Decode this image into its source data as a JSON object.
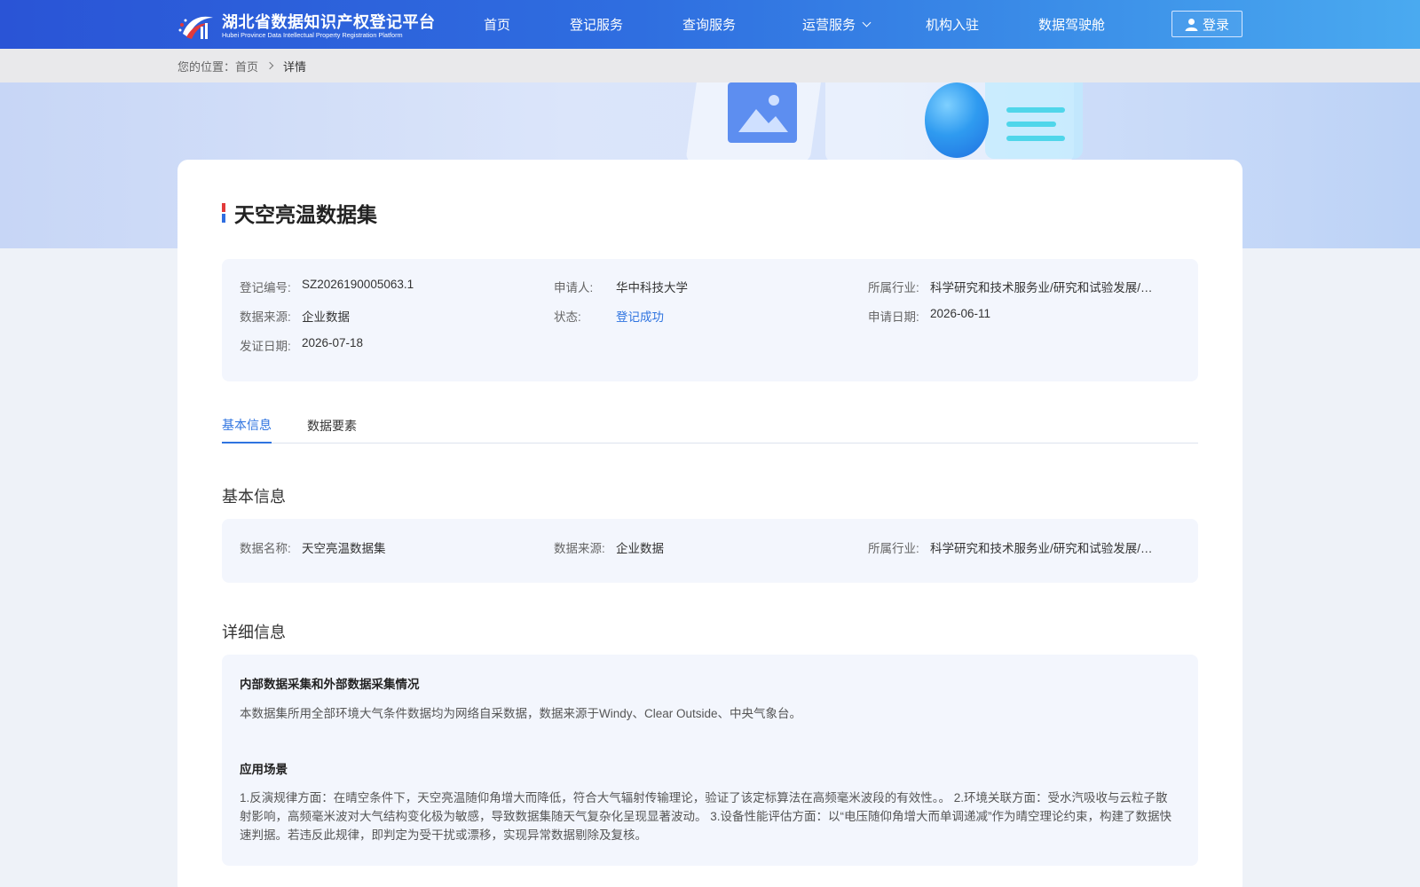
{
  "header": {
    "logo_cn": "湖北省数据知识产权登记平台",
    "logo_en": "Hubei Province Data Intellectual Property Registration Platform",
    "nav": [
      {
        "label": "首页"
      },
      {
        "label": "登记服务"
      },
      {
        "label": "查询服务"
      },
      {
        "label": "运营服务"
      },
      {
        "label": "机构入驻"
      },
      {
        "label": "数据驾驶舱"
      }
    ],
    "login_label": "登录"
  },
  "breadcrumb": {
    "prefix": "您的位置：",
    "home": "首页",
    "current": "详情"
  },
  "detail": {
    "title": "天空亮温数据集",
    "summary": {
      "reg_no_label": "登记编号:",
      "reg_no": "SZ2026190005063.1",
      "applicant_label": "申请人:",
      "applicant": "华中科技大学",
      "industry_label": "所属行业:",
      "industry": "科学研究和技术服务业/研究和试验发展/…",
      "source_label": "数据来源:",
      "source": "企业数据",
      "status_label": "状态:",
      "status": "登记成功",
      "apply_date_label": "申请日期:",
      "apply_date": "2026-06-11",
      "issue_date_label": "发证日期:",
      "issue_date": "2026-07-18"
    },
    "tabs": [
      {
        "label": "基本信息"
      },
      {
        "label": "数据要素"
      }
    ],
    "basic": {
      "section_title": "基本信息",
      "name_label": "数据名称:",
      "name": "天空亮温数据集",
      "source_label": "数据来源:",
      "source": "企业数据",
      "industry_label": "所属行业:",
      "industry": "科学研究和技术服务业/研究和试验发展/…"
    },
    "more": {
      "section_title": "详细信息",
      "collection_heading": "内部数据采集和外部数据采集情况",
      "collection_text": "本数据集所用全部环境大气条件数据均为网络自采数据，数据来源于Windy、Clear Outside、中央气象台。",
      "scenario_heading": "应用场景",
      "scenario_text": "1.反演规律方面：在晴空条件下，天空亮温随仰角增大而降低，符合大气辐射传输理论，验证了该定标算法在高频毫米波段的有效性。。 2.环境关联方面：受水汽吸收与云粒子散射影响，高频毫米波对大气结构变化极为敏感，导致数据集随天气复杂化呈现显著波动。 3.设备性能评估方面：以“电压随仰角增大而单调递减”作为晴空理论约束，构建了数据快速判据。若违反此规律，即判定为受干扰或漂移，实现异常数据剔除及复核。"
    }
  }
}
